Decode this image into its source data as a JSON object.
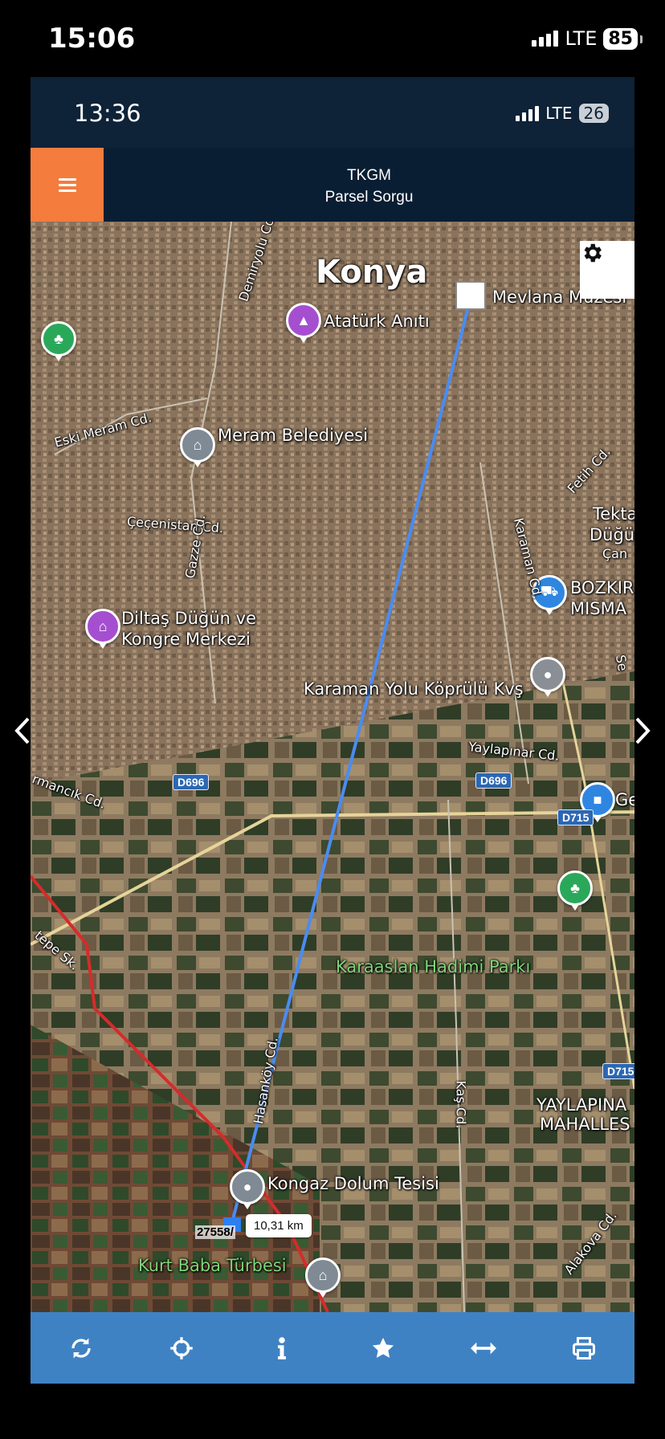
{
  "outer_status": {
    "time": "15:06",
    "network": "LTE",
    "battery": "85"
  },
  "inner_status": {
    "time": "13:36",
    "network": "LTE",
    "battery": "26"
  },
  "header": {
    "title": "TKGM",
    "subtitle": "Parsel Sorgu",
    "menu_icon": "hamburger-icon"
  },
  "map": {
    "settings_icon": "gear-icon",
    "city_label": "Konya",
    "pois": {
      "mevlana": "Mevlana Müzesi",
      "ataturk": "Atatürk Anıtı",
      "meram": "Meram Belediyesi",
      "diltas_1": "Diltaş Düğün ve",
      "diltas_2": "Kongre Merkezi",
      "karaman_kvs": "Karaman Yolu Köprülü Kvş",
      "karaaslan": "Karaaslan Hadimi Parkı",
      "kongaz": "Kongaz Dolum Tesisi",
      "kurt_baba": "Kurt Baba Türbesi",
      "bozkir_1": "BOZKIR",
      "bozkir_2": "MISMA",
      "tekta_1": "Tekta",
      "tekta_2": "Düğü",
      "tekta_3": "Çan",
      "yaylapinar_1": "YAYLAPINA",
      "yaylapinar_2": "MAHALLES",
      "ge": "Ge"
    },
    "streets": {
      "eski_meram": "Eski Meram Cd.",
      "cecenistan": "Çeçenistan Cd.",
      "gazze": "Gazze Cd.",
      "demiryolu": "Demiryolu Cd.",
      "karaman_cd": "Karaman Cd.",
      "fetih": "Fetih Cd.",
      "yaylapinar_cd": "Yaylapınar Cd.",
      "hasankoy": "Hasanköy Cd.",
      "kas": "Kaş Cd.",
      "alakova": "Alakova Cd.",
      "armancik": "rmancık Cd.",
      "tepe": "tepe Sk.",
      "se": "Se"
    },
    "road_badges": {
      "d696_left": "D696",
      "d696_right": "D696",
      "d715_top": "D715",
      "d715_bottom": "D715"
    },
    "measure": {
      "distance": "10,31 km",
      "parcel": "27558/"
    },
    "nav": {
      "prev_icon": "chevron-left-icon",
      "next_icon": "chevron-right-icon"
    }
  },
  "toolbar": [
    {
      "name": "refresh",
      "icon": "refresh-icon"
    },
    {
      "name": "locate",
      "icon": "crosshairs-icon"
    },
    {
      "name": "info",
      "icon": "info-icon"
    },
    {
      "name": "favorite",
      "icon": "star-icon"
    },
    {
      "name": "measure",
      "icon": "arrows-horizontal-icon"
    },
    {
      "name": "print",
      "icon": "print-icon"
    }
  ],
  "colors": {
    "header_bg": "#0a1e33",
    "menu_button": "#f47c3c",
    "toolbar_bg": "#3f82c4",
    "measure_line": "#4a8cf0",
    "boundary_line": "#d62b2b"
  }
}
